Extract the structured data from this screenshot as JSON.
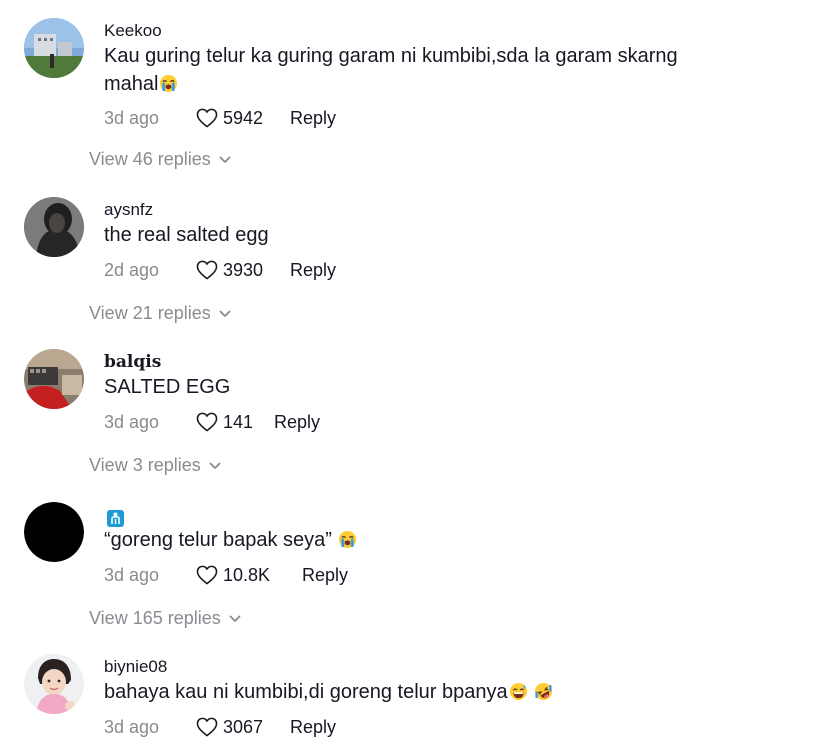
{
  "comments": [
    {
      "username": "Keekoo",
      "text": "Kau guring telur ka guring garam ni kumbibi,sda la garam skarng mahal",
      "date": "3d ago",
      "likes": "5942",
      "reply_label": "Reply",
      "view_replies": "View 46 replies",
      "emojis": [
        "loudly-crying-face"
      ]
    },
    {
      "username": "aysnfz",
      "text": "the real salted egg",
      "date": "2d ago",
      "likes": "3930",
      "reply_label": "Reply",
      "view_replies": "View 21 replies"
    },
    {
      "username": "balqis",
      "text": "SALTED EGG",
      "date": "3d ago",
      "likes": "141",
      "reply_label": "Reply",
      "view_replies": "View 3 replies"
    },
    {
      "username": "",
      "text": "“goreng telur bapak seya”",
      "date": "3d ago",
      "likes": "10.8K",
      "reply_label": "Reply",
      "view_replies": "View 165 replies",
      "emojis": [
        "loudly-crying-face"
      ]
    },
    {
      "username": "biynie08",
      "text": "bahaya kau ni kumbibi,di goreng telur bpanya",
      "date": "3d ago",
      "likes": "3067",
      "reply_label": "Reply",
      "emojis": [
        "grinning-sweat-face",
        "rolling-laughing-face"
      ]
    }
  ],
  "icons": {
    "like": "heart-outline-icon",
    "expand": "chevron-down-icon",
    "badge": "person-badge-icon"
  },
  "colors": {
    "text": "#161823",
    "secondary": "#8a8b91",
    "badge": "#1d9bd7"
  }
}
